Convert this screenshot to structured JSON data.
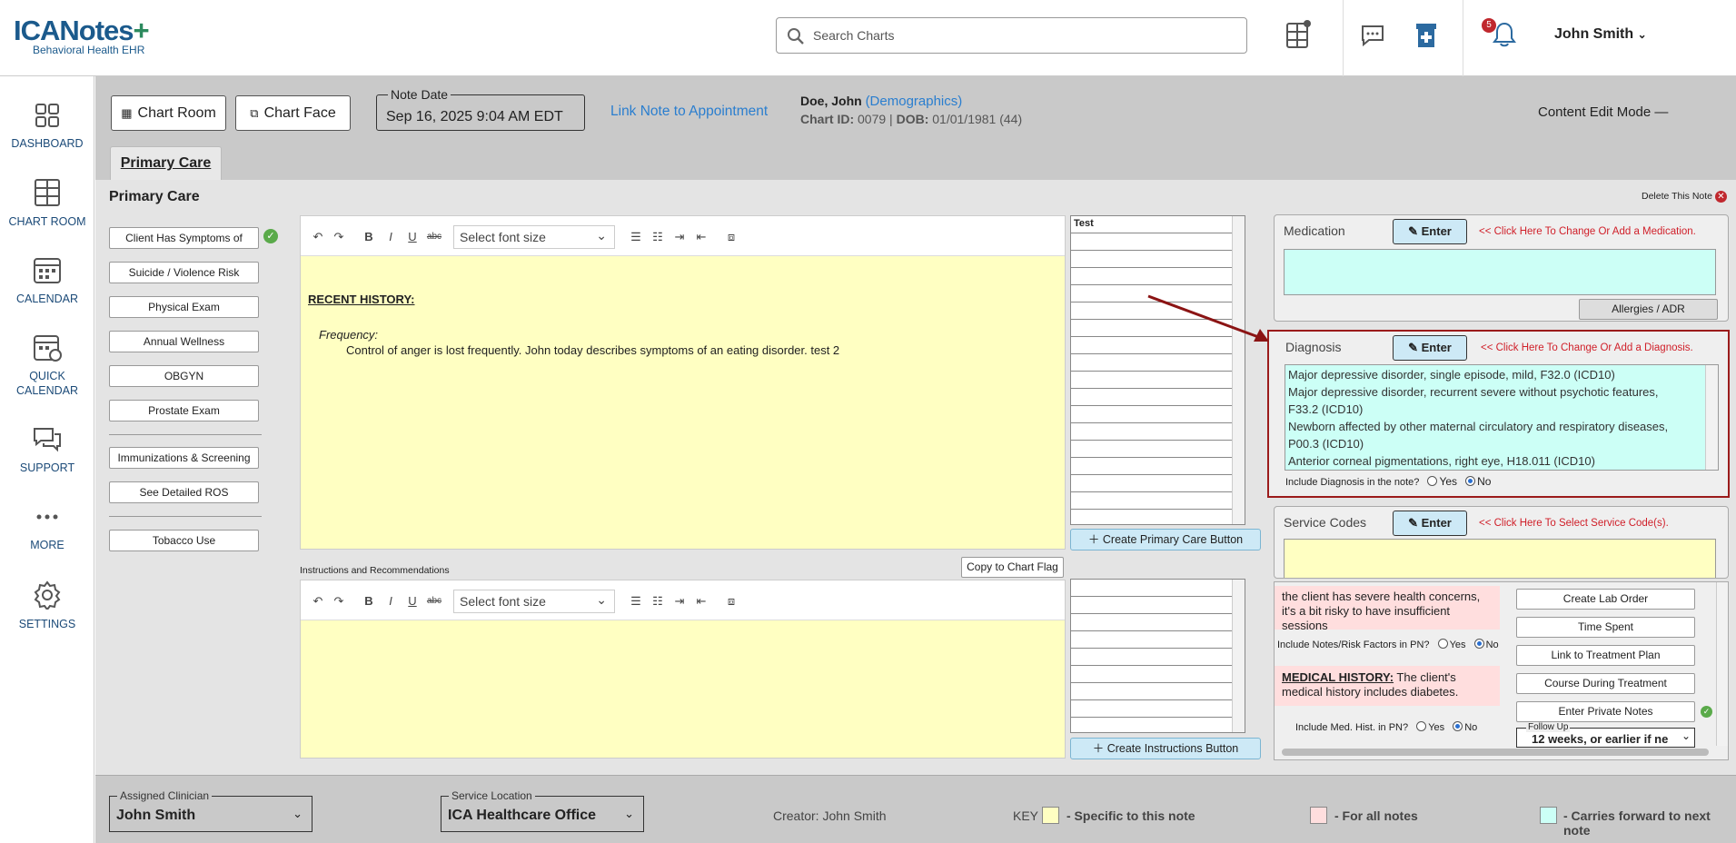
{
  "app": {
    "logo": "ICANotes",
    "logo_tagline": "Behavioral Health EHR"
  },
  "header": {
    "search_placeholder": "Search Charts",
    "notification_count": "5",
    "user_name": "John Smith"
  },
  "sidebar": {
    "items": [
      {
        "label": "DASHBOARD",
        "icon": "dashboard-icon"
      },
      {
        "label": "CHART ROOM",
        "icon": "cabinet-icon"
      },
      {
        "label": "CALENDAR",
        "icon": "calendar-icon"
      },
      {
        "label": "QUICK CALENDAR",
        "icon": "quick-calendar-icon"
      },
      {
        "label": "SUPPORT",
        "icon": "chat-icon"
      },
      {
        "label": "MORE",
        "icon": "more-icon"
      },
      {
        "label": "SETTINGS",
        "icon": "gear-icon"
      }
    ]
  },
  "toolbar": {
    "chart_room": "Chart Room",
    "chart_face": "Chart Face",
    "note_date_label": "Note Date",
    "note_date_value": "Sep 16, 2025 9:04 AM EDT",
    "link_note": "Link Note to Appointment",
    "patient_name": "Doe, John",
    "demographics": "(Demographics)",
    "chart_id_label": "Chart ID:",
    "chart_id": "0079",
    "dob_label": "DOB:",
    "dob": "01/01/1981 (44)",
    "content_edit_mode": "Content Edit Mode"
  },
  "tabs": [
    {
      "label": "Primary Care"
    }
  ],
  "section": {
    "title": "Primary Care",
    "delete_note": "Delete This Note"
  },
  "left_buttons": [
    "Client Has Symptoms of",
    "Suicide / Violence Risk",
    "Physical Exam",
    "Annual Wellness",
    "OBGYN",
    "Prostate Exam",
    "Immunizations & Screening",
    "See Detailed ROS",
    "Tobacco Use"
  ],
  "editor1": {
    "font_size_placeholder": "Select font size",
    "heading": "RECENT HISTORY:",
    "frequency_label": "Frequency:",
    "body": "Control of anger is lost frequently. John today describes symptoms of an eating disorder. test 2"
  },
  "grid1": {
    "header": "Test",
    "button": "Create Primary Care Button"
  },
  "editor2": {
    "label": "Instructions and Recommendations",
    "copy_button": "Copy to Chart Flag",
    "font_size_placeholder": "Select font size"
  },
  "grid2": {
    "button": "Create Instructions Button"
  },
  "medication": {
    "title": "Medication",
    "enter": "Enter",
    "hint": "<< Click Here To Change Or Add a Medication.",
    "allergies": "Allergies / ADR"
  },
  "diagnosis": {
    "title": "Diagnosis",
    "enter": "Enter",
    "hint": "<< Click Here To Change Or Add a Diagnosis.",
    "lines": [
      "Major depressive disorder, single episode, mild, F32.0 (ICD10)",
      "Major depressive disorder, recurrent severe without psychotic features,",
      "F33.2 (ICD10)",
      "Newborn affected by other maternal circulatory and respiratory diseases,",
      "P00.3 (ICD10)",
      "Anterior corneal pigmentations, right eye, H18.011 (ICD10)"
    ],
    "include_label": "Include Diagnosis in the note?",
    "yes": "Yes",
    "no": "No",
    "selected": "No"
  },
  "service_codes": {
    "title": "Service Codes",
    "enter": "Enter",
    "hint": "<< Click Here To Select Service Code(s)."
  },
  "risk": {
    "text": "the client has severe health concerns, it's a bit risky to have insufficient sessions",
    "include_label": "Include Notes/Risk Factors in PN?",
    "yes": "Yes",
    "no": "No"
  },
  "med_history": {
    "heading": "MEDICAL HISTORY:",
    "text": "The client's medical history includes diabetes.",
    "include_label": "Include Med. Hist. in PN?",
    "yes": "Yes",
    "no": "No"
  },
  "action_buttons": [
    "Create Lab Order",
    "Time Spent",
    "Link to Treatment Plan",
    "Course During Treatment",
    "Enter Private Notes"
  ],
  "follow_up": {
    "label": "Follow Up",
    "value": "12 weeks, or earlier if ne"
  },
  "footer": {
    "clinician_label": "Assigned Clinician",
    "clinician": "John Smith",
    "location_label": "Service Location",
    "location": "ICA Healthcare Office",
    "creator": "Creator: John Smith",
    "key": "KEY",
    "key_yellow": "- Specific to this note",
    "key_pink": "- For all notes",
    "key_cyan": "- Carries forward to next note"
  },
  "colors": {
    "yellow": "#ffffc2",
    "pink": "#ffdede",
    "cyan": "#ccfff6",
    "accent": "#2a7ecf",
    "red": "#d0202a"
  }
}
